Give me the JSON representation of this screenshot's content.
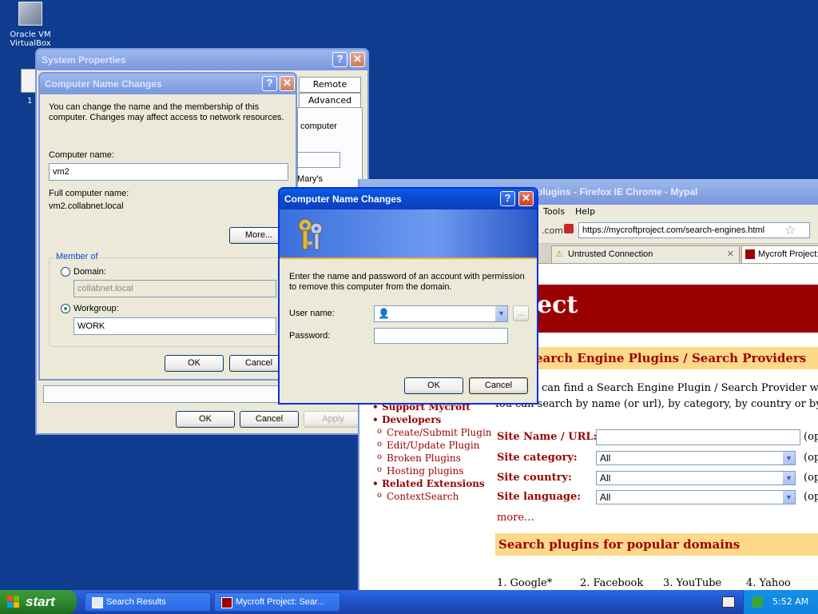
{
  "desktop": {
    "icon_label": "Oracle VM VirtualBox",
    "icon2_label": "1"
  },
  "sysprops": {
    "title": "System Properties",
    "tabs": [
      "Remote",
      "Advanced"
    ],
    "partial_text1": "computer",
    "partial_text2": "Mary's",
    "ok": "OK",
    "cancel": "Cancel",
    "apply": "Apply"
  },
  "cnc_back": {
    "title": "Computer Name Changes",
    "description": "You can change the name and the membership of this computer. Changes may affect access to network resources.",
    "computer_name_label": "Computer name:",
    "computer_name_value": "vm2",
    "full_name_label": "Full computer name:",
    "full_name_value": "vm2.collabnet.local",
    "more_button": "More...",
    "member_of_label": "Member of",
    "domain_label": "Domain:",
    "domain_value": "collabnet.local",
    "workgroup_label": "Workgroup:",
    "workgroup_value": "WORK",
    "ok": "OK",
    "cancel": "Cancel"
  },
  "cnc_front": {
    "title": "Computer Name Changes",
    "description": "Enter the name and password of an account with permission to remove this computer from the domain.",
    "username_label": "User name:",
    "username_value": "",
    "password_label": "Password:",
    "password_value": "",
    "browse_button": "...",
    "ok": "OK",
    "cancel": "Cancel"
  },
  "firefox": {
    "title": "plugins - Firefox IE Chrome - Mypal",
    "menu": [
      "Tools",
      "Help"
    ],
    "url_prefix": ".com",
    "url": "https://mycroftproject.com/search-engines.html",
    "tabs": [
      "Untrusted Connection",
      "Mycroft Project:"
    ],
    "banner": "ect",
    "heading1": "earch Engine Plugins / Search Providers",
    "intro_line1": "can find a Search Engine Plugin / Search Provider which y",
    "intro_line2": "fou can search by name (or url), by category, by country or by lang",
    "site_name_label": "Site Name / URL:",
    "site_category_label": "Site category:",
    "site_country_label": "Site country:",
    "site_language_label": "Site language:",
    "select_all": "All",
    "opt_label": "(op",
    "more_link": "more...",
    "heading2": "Search plugins for popular domains",
    "popular": [
      "1. Google*",
      "2. Facebook",
      "3. YouTube",
      "4. Yahoo"
    ],
    "nav": [
      {
        "label": "Support Mycroft",
        "kind": "top"
      },
      {
        "label": "Developers",
        "kind": "top"
      },
      {
        "label": "Create/Submit Plugin",
        "kind": "sub"
      },
      {
        "label": "Edit/Update Plugin",
        "kind": "sub"
      },
      {
        "label": "Broken Plugins",
        "kind": "sub"
      },
      {
        "label": "Hosting plugins",
        "kind": "sub"
      },
      {
        "label": "Related Extensions",
        "kind": "top"
      },
      {
        "label": "ContextSearch",
        "kind": "sub"
      }
    ]
  },
  "taskbar": {
    "start": "start",
    "items": [
      "Search Results",
      "Mycroft Project: Sear..."
    ],
    "clock": "5:52 AM"
  }
}
